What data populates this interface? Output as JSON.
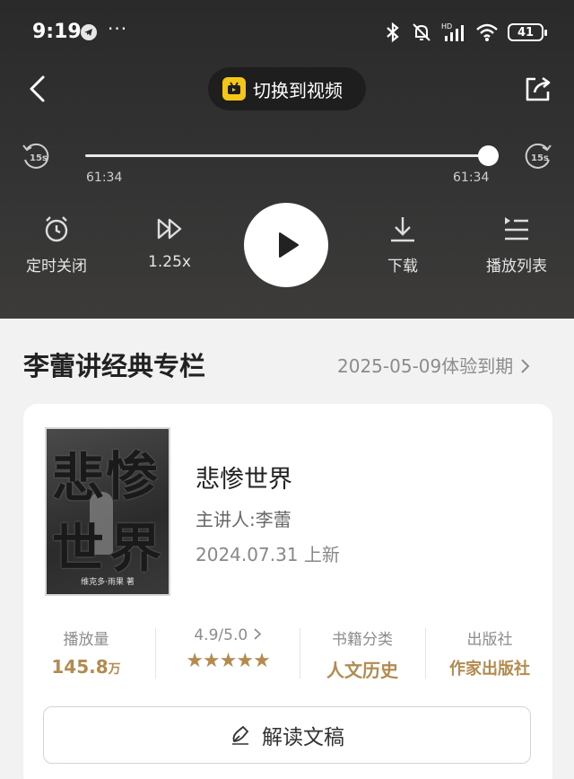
{
  "status_bar": {
    "time": "9:19",
    "dots": "···",
    "battery": "41",
    "network_label": "HD"
  },
  "header": {
    "switch_label": "切换到视频"
  },
  "progress": {
    "current": "61:34",
    "total": "61:34",
    "fraction": 1.0
  },
  "controls": {
    "timer_label": "定时关闭",
    "speed_label": "1.25x",
    "download_label": "下载",
    "playlist_label": "播放列表",
    "skip_back_label": "15s",
    "skip_forward_label": "15s"
  },
  "section": {
    "title": "李蕾讲经典专栏",
    "expire": "2025-05-09体验到期"
  },
  "book": {
    "title": "悲惨世界",
    "speaker": "主讲人:李蕾",
    "date": "2024.07.31 上新",
    "cover_text": [
      "悲",
      "惨",
      "世",
      "界"
    ],
    "cover_author": "维克多·雨果 著"
  },
  "stats": {
    "plays_label": "播放量",
    "plays_value": "145.8",
    "plays_unit": "万",
    "rating_label": "4.9/5.0",
    "rating_stars": "★★★★★",
    "category_label": "书籍分类",
    "category_value": "人文历史",
    "publisher_label": "出版社",
    "publisher_value": "作家出版社"
  },
  "read_button": {
    "label": "解读文稿"
  },
  "colors": {
    "accent_gold": "#b48a4e",
    "switch_icon": "#f5c518"
  }
}
